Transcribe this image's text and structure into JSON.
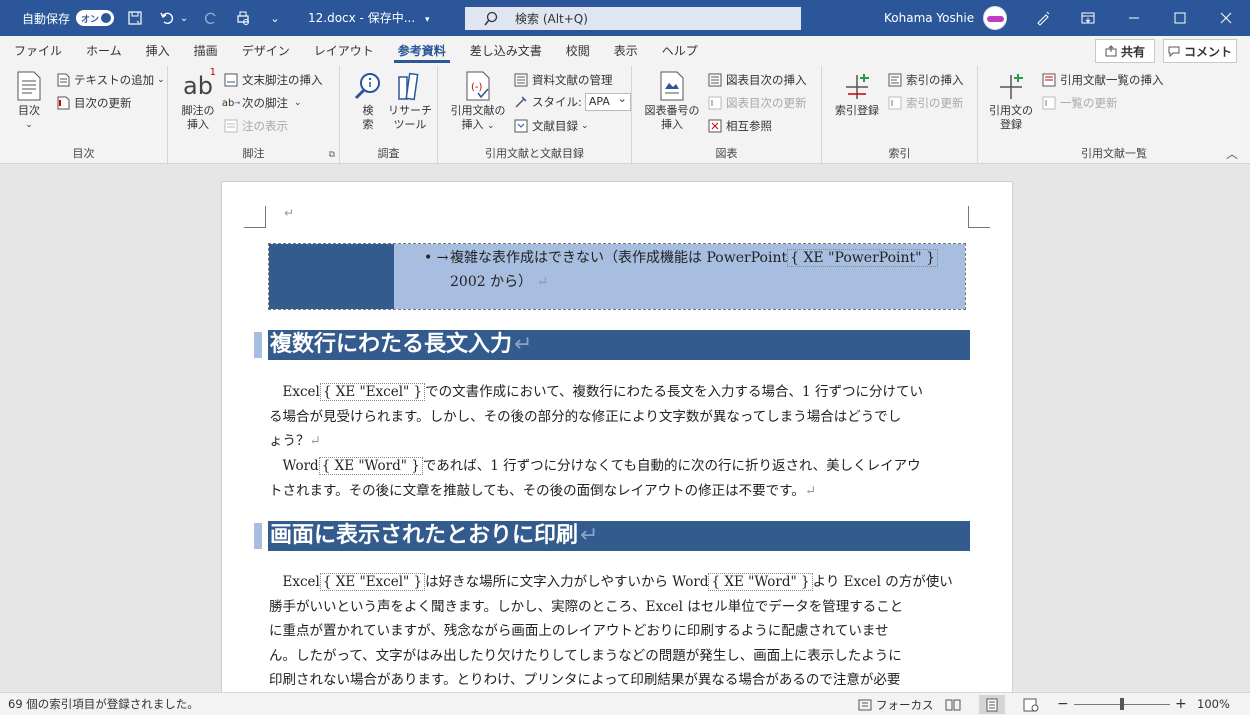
{
  "titlebar": {
    "autosave_label": "自動保存",
    "autosave_state": "オン",
    "document_title": "12.docx - 保存中...",
    "search_placeholder": "検索 (Alt+Q)",
    "user_name": "Kohama Yoshie"
  },
  "tabs": [
    "ファイル",
    "ホーム",
    "挿入",
    "描画",
    "デザイン",
    "レイアウト",
    "参考資料",
    "差し込み文書",
    "校閲",
    "表示",
    "ヘルプ"
  ],
  "active_tab": "参考資料",
  "share_label": "共有",
  "comment_label": "コメント",
  "ribbon": {
    "toc": {
      "group_label": "目次",
      "big": "目次",
      "add_text": "テキストの追加",
      "update_toc": "目次の更新"
    },
    "footnotes": {
      "group_label": "脚注",
      "big1": "脚注の",
      "big2": "挿入",
      "insert_endnote": "文末脚注の挿入",
      "next_footnote": "次の脚注",
      "show_notes": "注の表示"
    },
    "research": {
      "group_label": "調査",
      "search1": "検",
      "search2": "索",
      "researcher1": "リサーチ",
      "researcher2": "ツール"
    },
    "citations": {
      "group_label": "引用文献と文献目録",
      "big1": "引用文献の",
      "big2": "挿入",
      "manage_sources": "資料文献の管理",
      "style_label": "スタイル:",
      "style_value": "APA",
      "bibliography": "文献目録"
    },
    "captions": {
      "group_label": "図表",
      "big1": "図表番号の",
      "big2": "挿入",
      "insert_tof": "図表目次の挿入",
      "update_table": "図表目次の更新",
      "cross_ref": "相互参照"
    },
    "index": {
      "group_label": "索引",
      "big": "索引登録",
      "insert_index": "索引の挿入",
      "update_index": "索引の更新"
    },
    "toa": {
      "group_label": "引用文献一覧",
      "big1": "引用文の",
      "big2": "登録",
      "insert_toa": "引用文献一覧の挿入",
      "update_toa": "一覧の更新"
    }
  },
  "document": {
    "bullet_line1": "複雑な表作成はできない（表作成機能は PowerPoint",
    "bullet_xe1": "XE \"PowerPoint\"",
    "bullet_line2": "2002 から）",
    "heading1": "複数行にわたる長文入力",
    "p1_l1_a": "Excel",
    "p1_l1_xe": "XE \"Excel\"",
    "p1_l1_b": "での文書作成において、複数行にわたる長文を入力する場合、1 行ずつに分けてい",
    "p1_l2": "る場合が見受けられます。しかし、その後の部分的な修正により文字数が異なってしまう場合はどうでし",
    "p1_l3": "ょう？",
    "p2_l1_a": "Word",
    "p2_l1_xe": "XE \"Word\"",
    "p2_l1_b": "であれば、1 行ずつに分けなくても自動的に次の行に折り返され、美しくレイアウ",
    "p2_l2": "トされます。その後に文章を推敲しても、その後の面倒なレイアウトの修正は不要です。",
    "heading2": "画面に表示されたとおりに印刷",
    "p3_l1_a": "Excel",
    "p3_l1_xe1": "XE \"Excel\"",
    "p3_l1_b": "は好きな場所に文字入力がしやすいから Word",
    "p3_l1_xe2": "XE \"Word\"",
    "p3_l1_c": "より Excel の方が使い",
    "p3_l2": "勝手がいいという声をよく聞きます。しかし、実際のところ、Excel はセル単位でデータを管理すること",
    "p3_l3": "に重点が置かれていますが、残念ながら画面上のレイアウトどおりに印刷するように配慮されていませ",
    "p3_l4": "ん。したがって、文字がはみ出したり欠けたりしてしまうなどの問題が発生し、画面上に表示したように",
    "p3_l5": "印刷されない場合があります。とりわけ、プリンタによって印刷結果が異なる場合があるので注意が必要"
  },
  "status": {
    "message": "69 個の索引項目が登録されました。",
    "focus_label": "フォーカス",
    "zoom": "100%"
  },
  "colors": {
    "title_bar": "#2b579a",
    "heading_bg": "#335b8e",
    "table_light": "#a7bee0"
  }
}
